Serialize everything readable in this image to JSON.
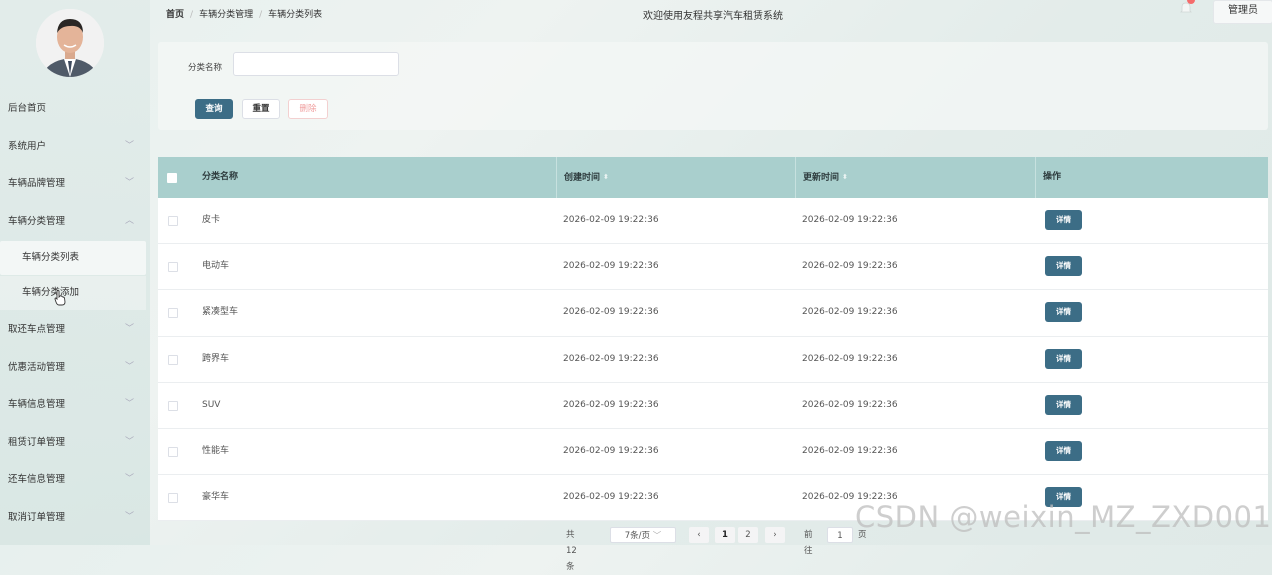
{
  "sidebar": {
    "items": [
      {
        "label": "后台首页",
        "has_children": false
      },
      {
        "label": "系统用户",
        "has_children": true,
        "chevron": "﹀"
      },
      {
        "label": "车辆品牌管理",
        "has_children": true,
        "chevron": "﹀"
      },
      {
        "label": "车辆分类管理",
        "has_children": true,
        "chevron": "︿",
        "expanded": true,
        "children": [
          {
            "label": "车辆分类列表",
            "active": true
          },
          {
            "label": "车辆分类添加",
            "hover": true
          }
        ]
      },
      {
        "label": "取还车点管理",
        "has_children": true,
        "chevron": "﹀"
      },
      {
        "label": "优惠活动管理",
        "has_children": true,
        "chevron": "﹀"
      },
      {
        "label": "车辆信息管理",
        "has_children": true,
        "chevron": "﹀"
      },
      {
        "label": "租赁订单管理",
        "has_children": true,
        "chevron": "﹀"
      },
      {
        "label": "还车信息管理",
        "has_children": true,
        "chevron": "﹀"
      },
      {
        "label": "取消订单管理",
        "has_children": true,
        "chevron": "﹀"
      }
    ]
  },
  "header": {
    "breadcrumb": [
      "首页",
      "车辆分类管理",
      "车辆分类列表"
    ],
    "welcome": "欢迎使用友程共享汽车租赁系统",
    "user_label": "管理员"
  },
  "search": {
    "label": "分类名称",
    "value": "",
    "placeholder": "",
    "query_label": "查询",
    "reset_label": "重置",
    "delete_label": "删除"
  },
  "table": {
    "headers": {
      "name": "分类名称",
      "create_time": "创建时间",
      "update_time": "更新时间",
      "action": "操作"
    },
    "sort_glyph": "⬍",
    "detail_label": "详情",
    "rows": [
      {
        "name": "皮卡",
        "create_time": "2026-02-09 19:22:36",
        "update_time": "2026-02-09 19:22:36"
      },
      {
        "name": "电动车",
        "create_time": "2026-02-09 19:22:36",
        "update_time": "2026-02-09 19:22:36"
      },
      {
        "name": "紧凑型车",
        "create_time": "2026-02-09 19:22:36",
        "update_time": "2026-02-09 19:22:36"
      },
      {
        "name": "跨界车",
        "create_time": "2026-02-09 19:22:36",
        "update_time": "2026-02-09 19:22:36"
      },
      {
        "name": "SUV",
        "create_time": "2026-02-09 19:22:36",
        "update_time": "2026-02-09 19:22:36"
      },
      {
        "name": "性能车",
        "create_time": "2026-02-09 19:22:36",
        "update_time": "2026-02-09 19:22:36"
      },
      {
        "name": "豪华车",
        "create_time": "2026-02-09 19:22:36",
        "update_time": "2026-02-09 19:22:36"
      }
    ]
  },
  "pagination": {
    "total": "共 12 条",
    "page_size": "7条/页",
    "prev": "‹",
    "next": "›",
    "pages": [
      "1",
      "2"
    ],
    "current": "1",
    "goto_label": "前往",
    "goto_value": "1",
    "page_suffix": "页"
  },
  "watermark": "CSDN @weixin_MZ_ZXD001",
  "colors": {
    "primary": "#3c6d86",
    "table_header": "#a9cfcd",
    "badge": "#f56c6c"
  }
}
